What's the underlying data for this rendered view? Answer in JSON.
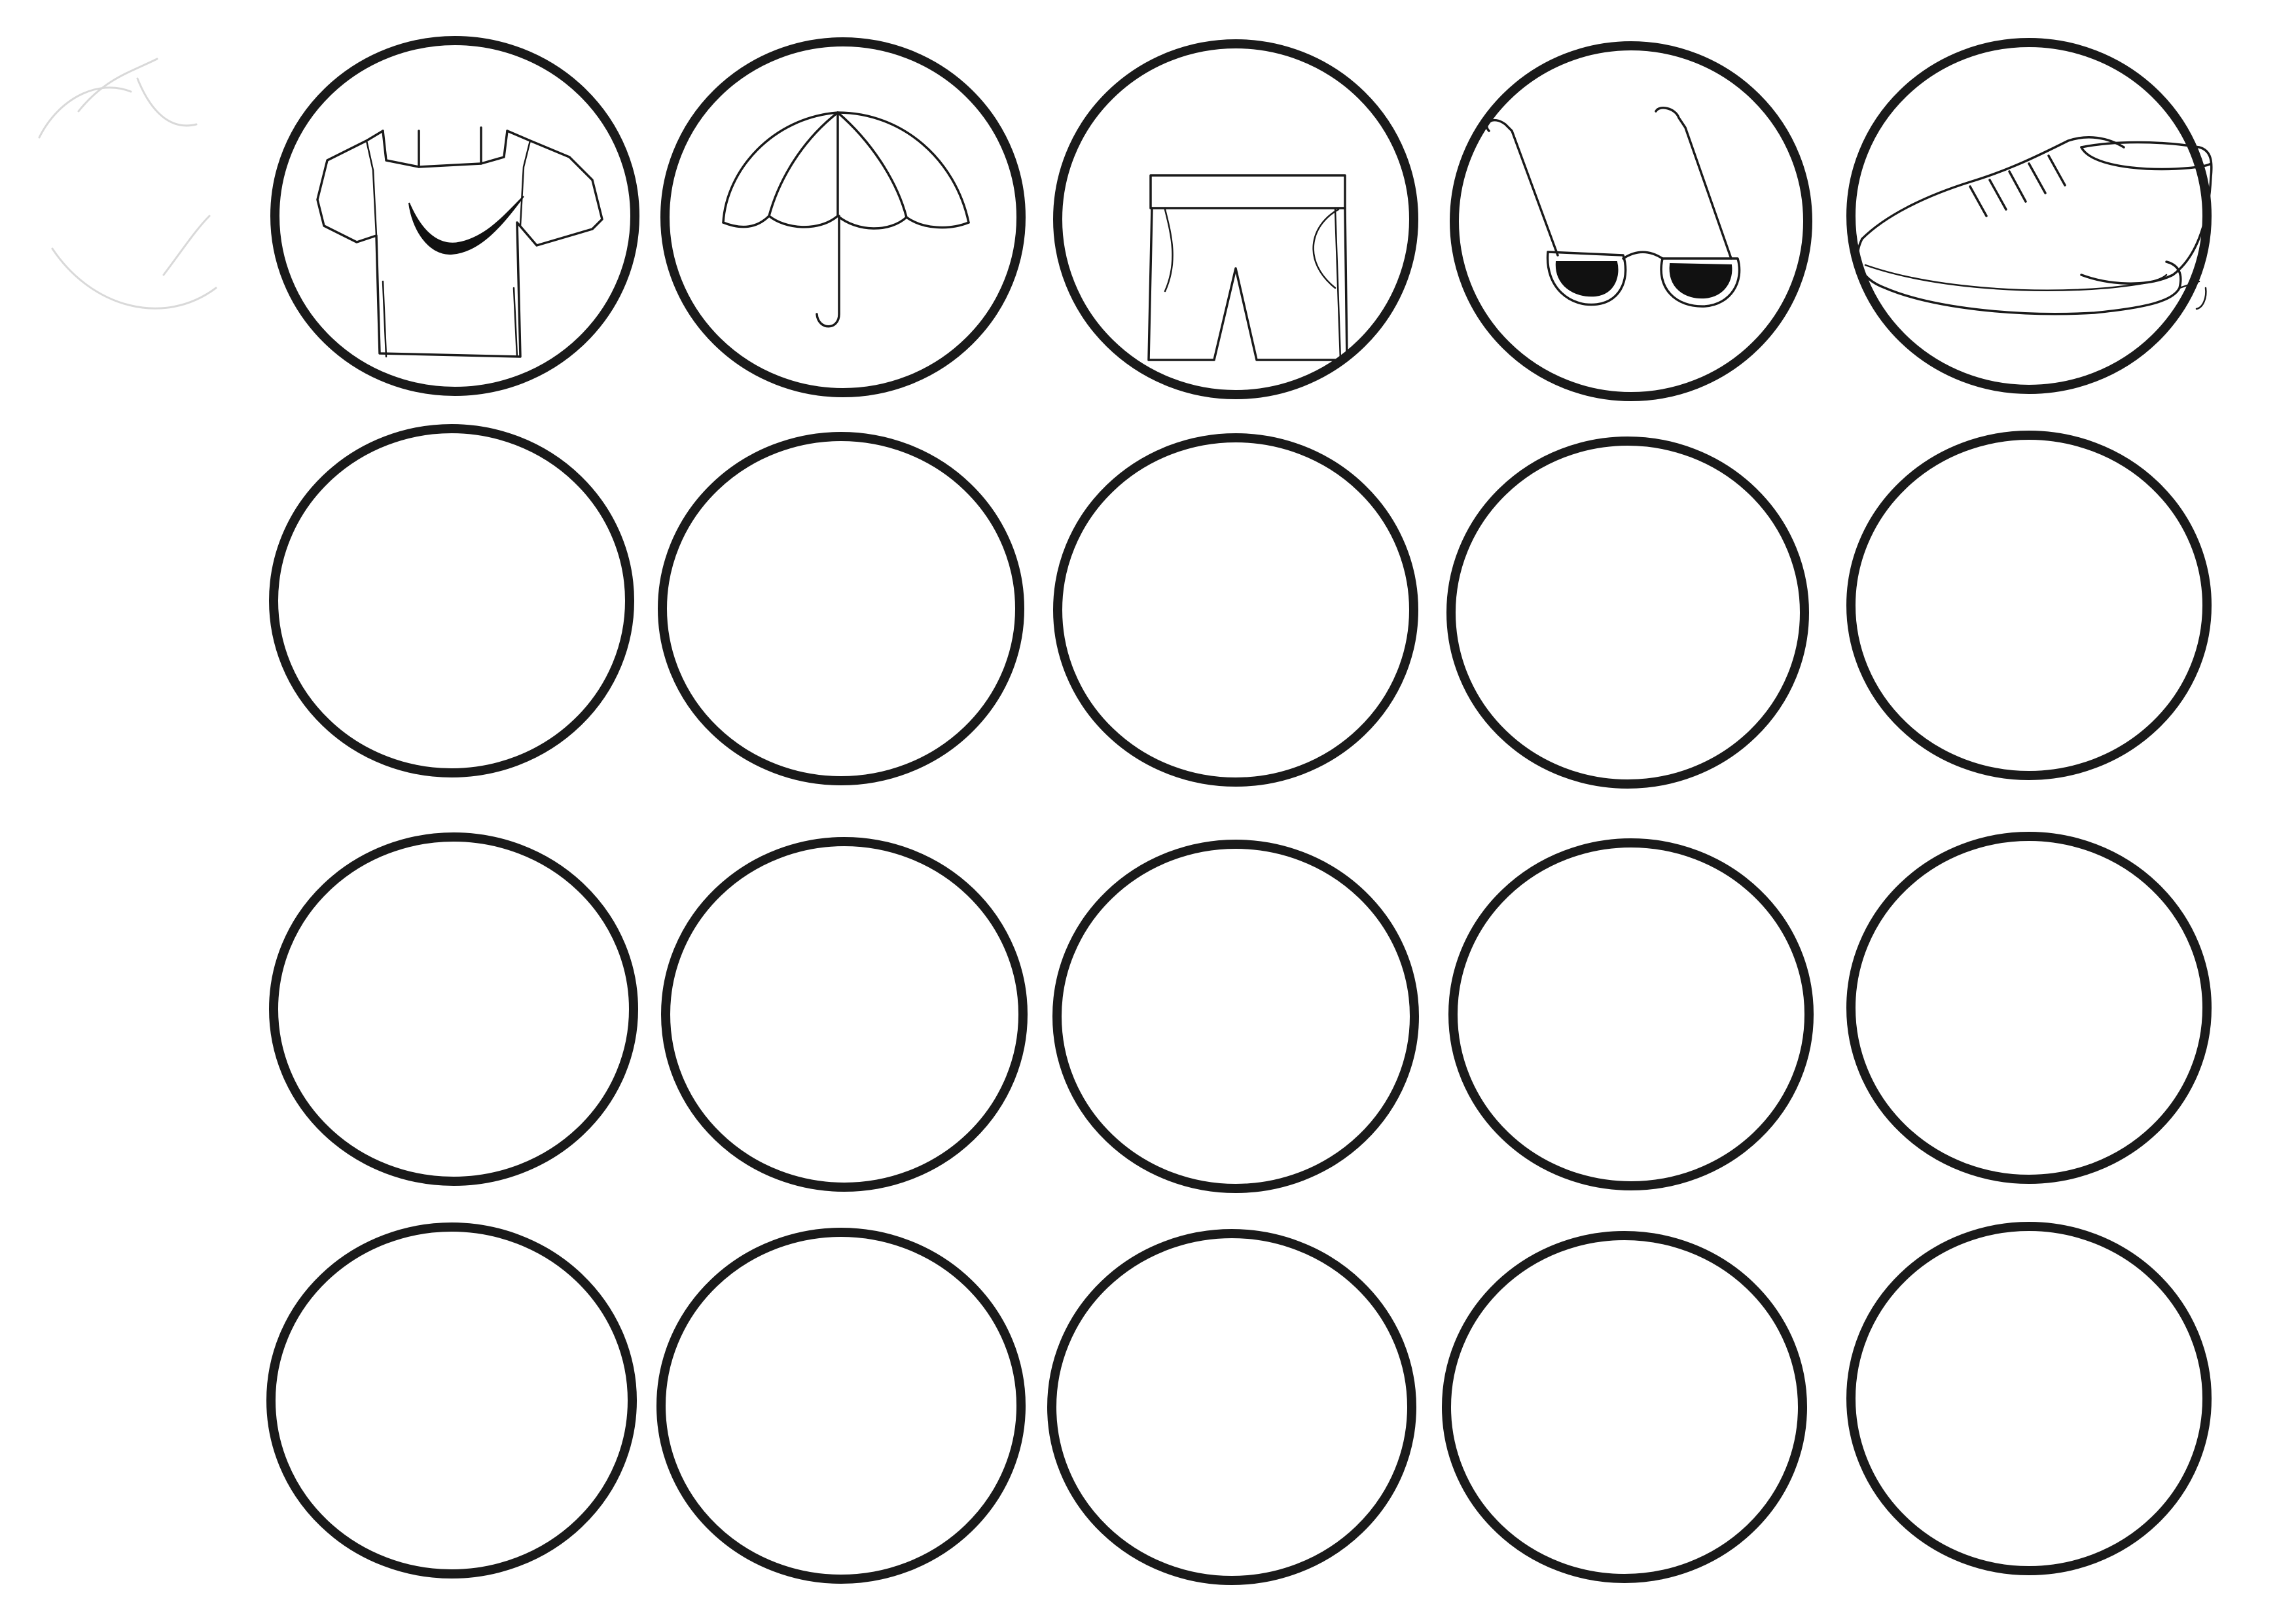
{
  "worksheet": {
    "rows": 4,
    "columns": 5,
    "ring_color": "#1a1a1a",
    "background_color": "#ffffff",
    "icons_row": [
      {
        "icon": "t-shirt-icon"
      },
      {
        "icon": "umbrella-icon"
      },
      {
        "icon": "shorts-icon"
      },
      {
        "icon": "sunglasses-icon"
      },
      {
        "icon": "sneaker-icon"
      }
    ]
  }
}
